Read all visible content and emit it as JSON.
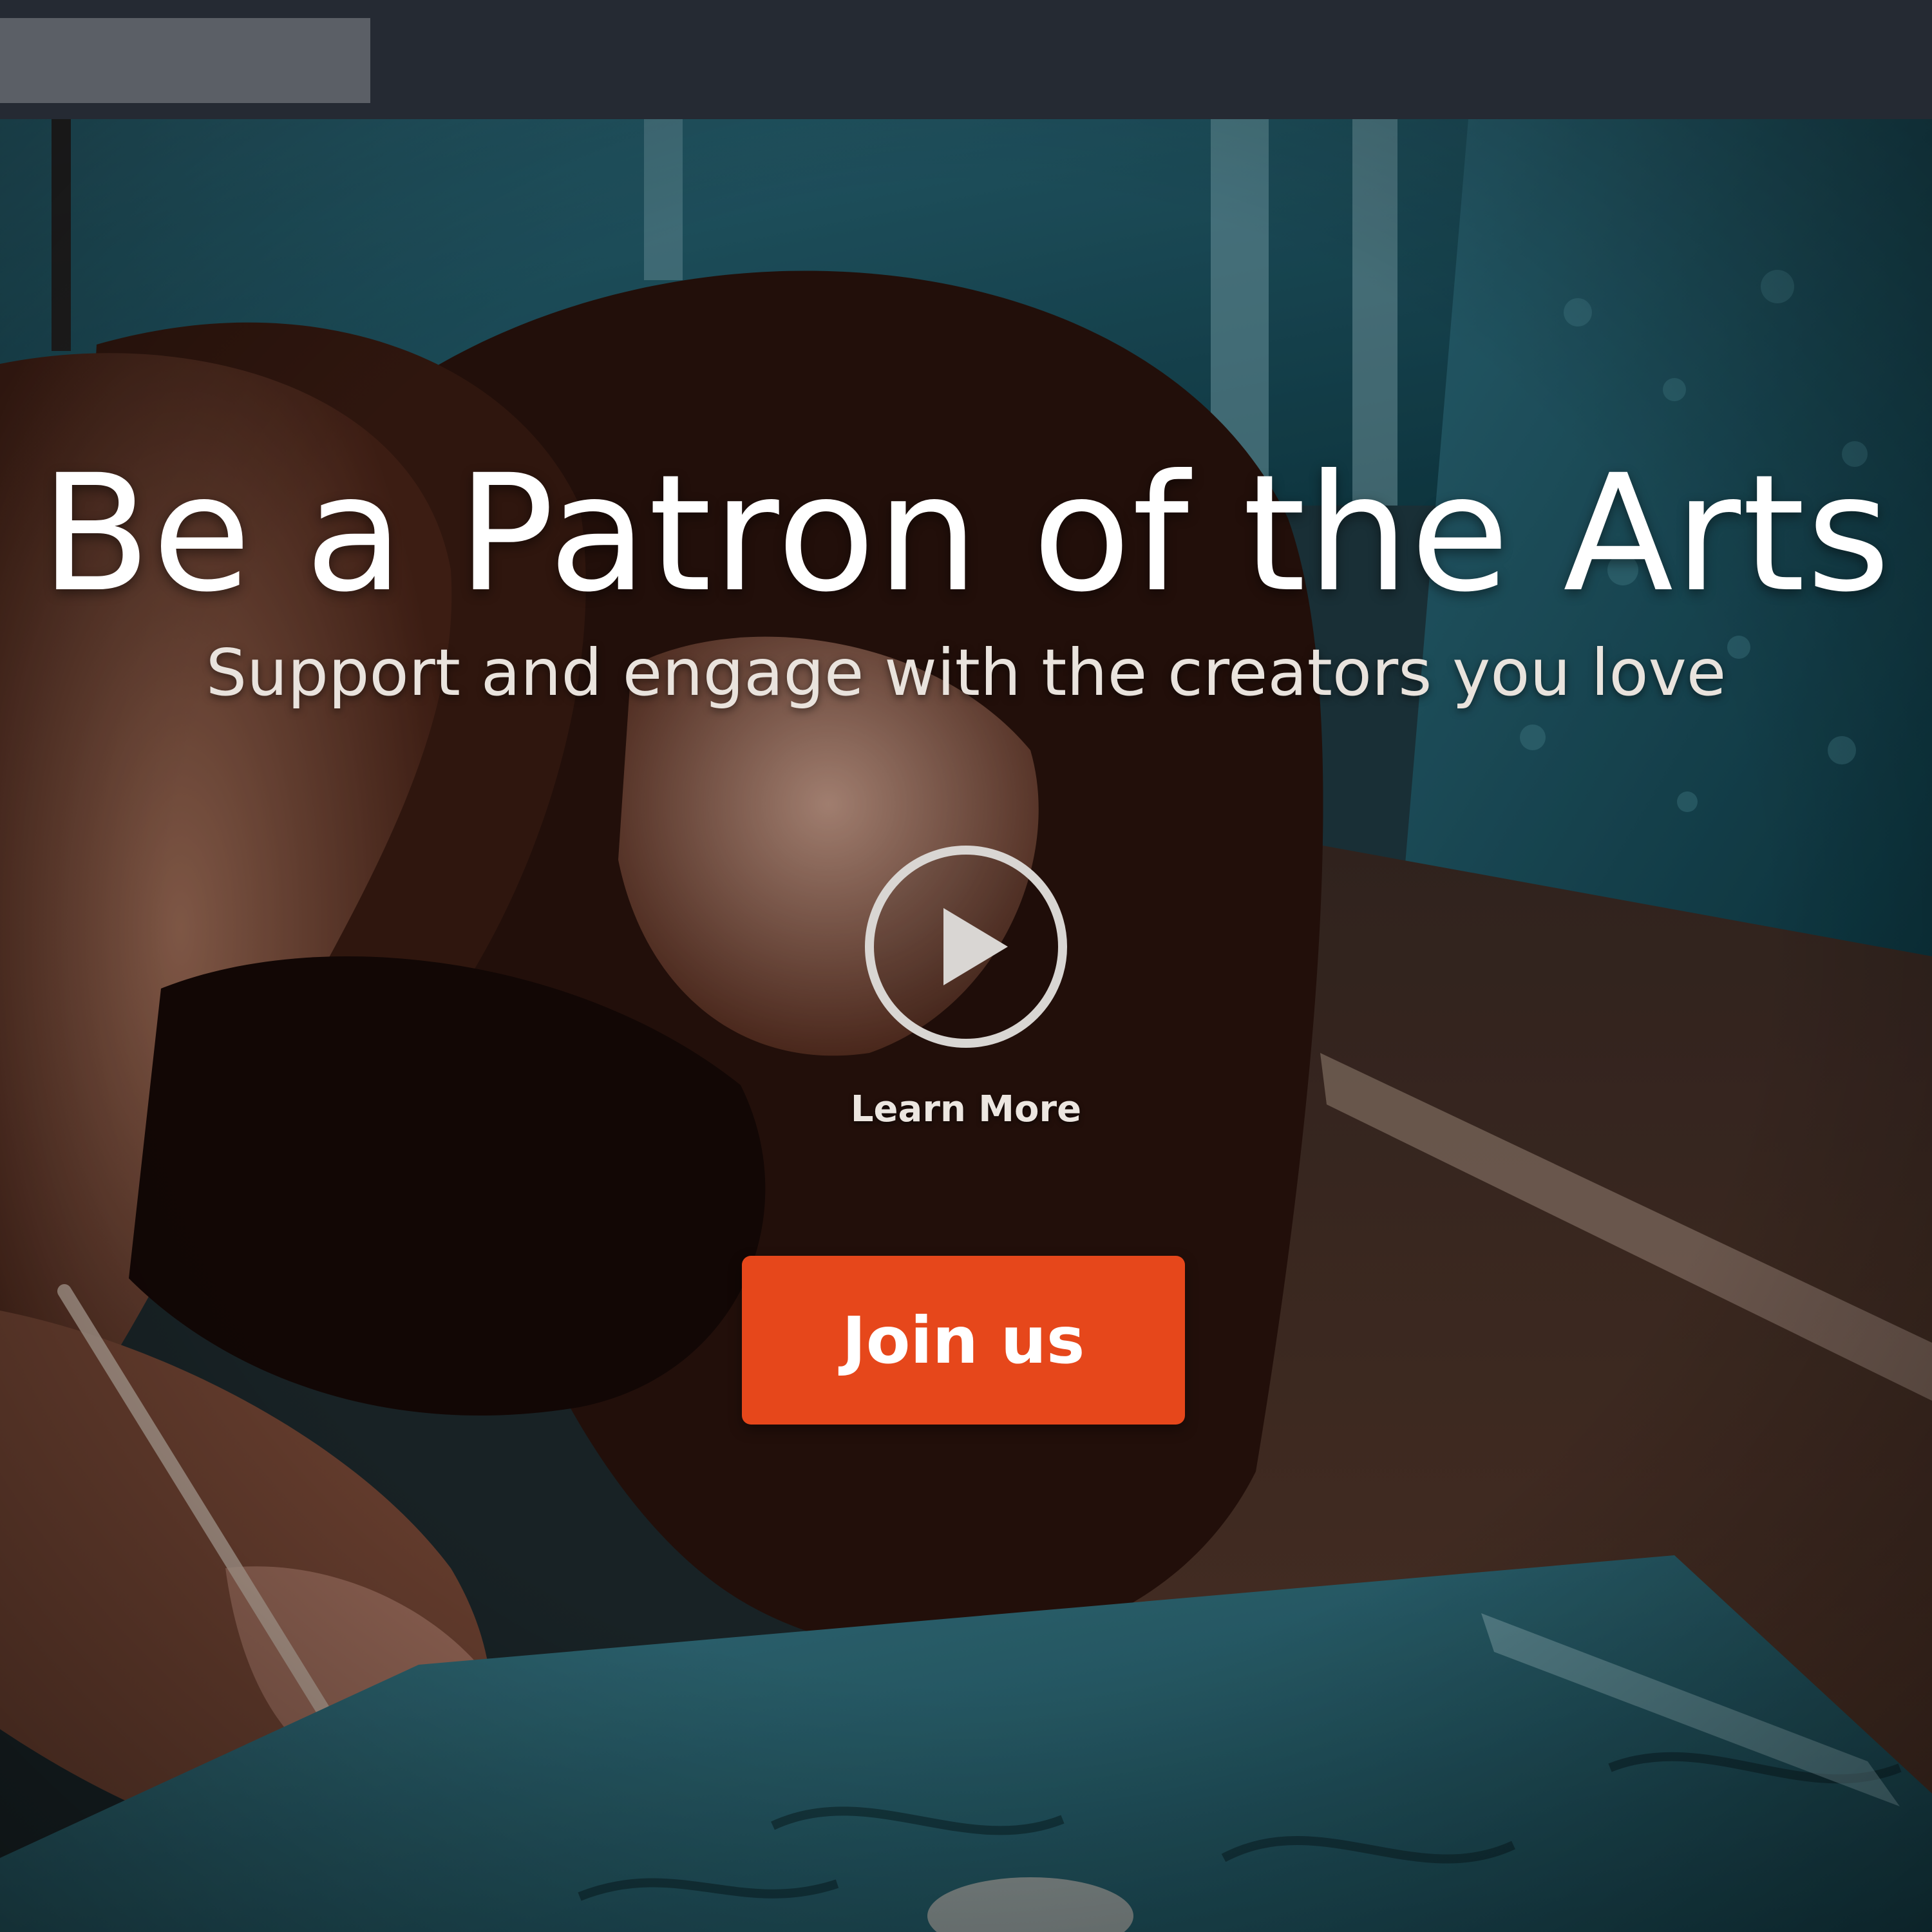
{
  "hero": {
    "title": "Be a Patron of the Arts",
    "subtitle": "Support and engage with the creators you love",
    "learn_more_label": "Learn More",
    "join_label": "Join us",
    "play_icon": "play-circle-icon"
  },
  "colors": {
    "topbar": "#252a33",
    "join_button": "#e6471b",
    "text": "#ffffff"
  }
}
